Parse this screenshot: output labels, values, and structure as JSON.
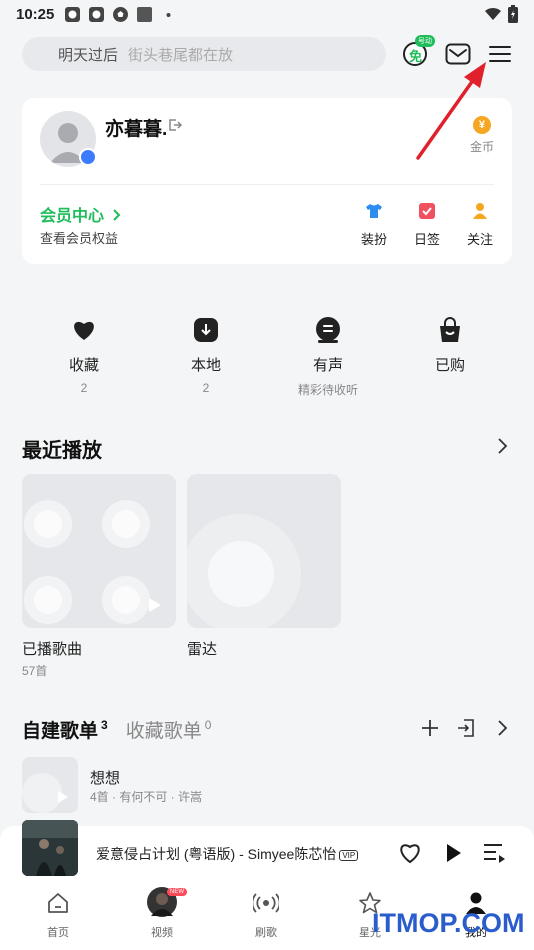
{
  "status_bar": {
    "time": "10:25"
  },
  "header": {
    "search_hint_primary": "明天过后",
    "search_hint_secondary": "街头巷尾都在放",
    "free_badge_top": "号动",
    "free_badge_main": "免"
  },
  "profile": {
    "username": "亦暮暮.",
    "coin_label": "金币",
    "coin_symbol": "¥",
    "vip_center": "会员中心",
    "vip_sub": "查看会员权益",
    "actions": [
      {
        "label": "装扮"
      },
      {
        "label": "日签"
      },
      {
        "label": "关注"
      }
    ]
  },
  "quick_links": [
    {
      "label": "收藏",
      "sub": "2"
    },
    {
      "label": "本地",
      "sub": "2"
    },
    {
      "label": "有声",
      "sub": "精彩待收听"
    },
    {
      "label": "已购",
      "sub": ""
    }
  ],
  "recent": {
    "title": "最近播放",
    "tiles": [
      {
        "label": "已播歌曲",
        "sub": "57首"
      },
      {
        "label": "雷达",
        "sub": ""
      }
    ]
  },
  "playlists": {
    "tab_created": "自建歌单",
    "tab_created_count": "3",
    "tab_collected": "收藏歌单",
    "tab_collected_count": "0",
    "items": [
      {
        "title": "想想",
        "meta": "4首 · 有何不可 · 许嵩"
      }
    ]
  },
  "player": {
    "song": "爱意侵占计划 (粤语版) - Simyee陈芯怡",
    "vip_tag": "VIP"
  },
  "bottom_nav": [
    {
      "label": "首页"
    },
    {
      "label": "视频",
      "badge": "NEW"
    },
    {
      "label": "刷歌"
    },
    {
      "label": "星光"
    },
    {
      "label": "我的"
    }
  ],
  "watermark": "ITMOP.COM",
  "colors": {
    "accent_green": "#1fbd5a",
    "coin": "#f5a623",
    "annotation_arrow": "#e0202a"
  }
}
